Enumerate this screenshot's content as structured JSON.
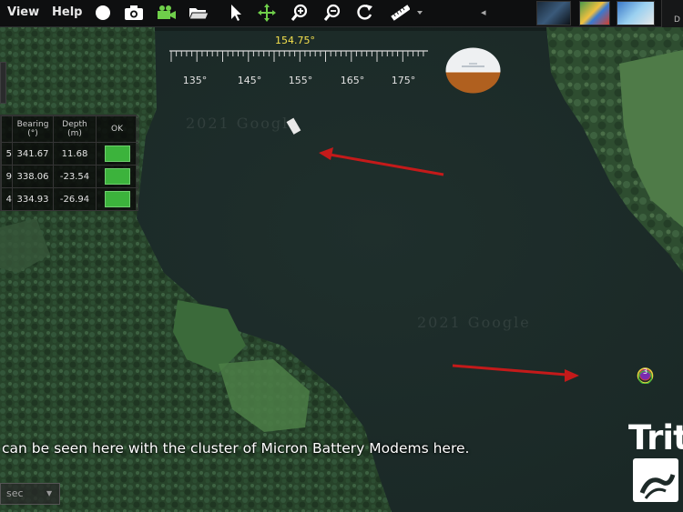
{
  "menu": {
    "view": "View",
    "help": "Help"
  },
  "toolbar_icons": [
    "record-icon",
    "camera-icon",
    "video-icon",
    "folder-open-icon",
    "pointer-icon",
    "pan-icon",
    "zoom-in-icon",
    "zoom-out-icon",
    "refresh-icon",
    "ruler-icon",
    "dropdown-icon"
  ],
  "heading": {
    "value": "154.75°",
    "ticks": [
      "135°",
      "145°",
      "155°",
      "165°",
      "175°"
    ]
  },
  "table": {
    "headers": {
      "bearing": "Bearing",
      "bearing_unit": "(°)",
      "depth": "Depth",
      "depth_unit": "(m)",
      "ok": "OK"
    },
    "rows": [
      {
        "id": "5",
        "bearing": "341.67",
        "depth": "11.68",
        "ok": true
      },
      {
        "id": "9",
        "bearing": "338.06",
        "depth": "-23.54",
        "ok": true
      },
      {
        "id": "4",
        "bearing": "334.93",
        "depth": "-26.94",
        "ok": true
      }
    ]
  },
  "marker": {
    "label": "3"
  },
  "caption": "can be seen here with the cluster of Micron Battery Modems here.",
  "status": {
    "text": "sec"
  },
  "logo": {
    "text": "Trit"
  },
  "thumbnail_end_label": "D",
  "watermarks": [
    "2021 Google",
    "2021 Google"
  ],
  "colors": {
    "arrow": "#c41a1a",
    "ok": "#3cb33c",
    "heading": "#f4e04d"
  }
}
